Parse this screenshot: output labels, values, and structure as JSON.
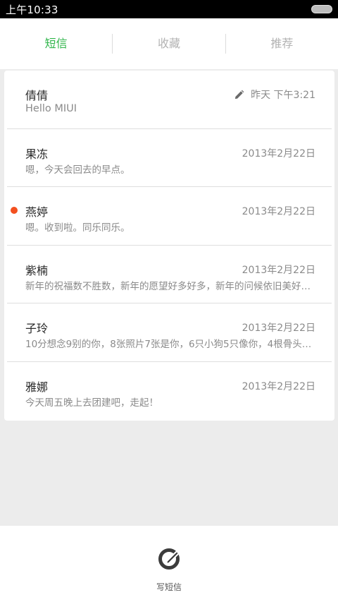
{
  "status_bar": {
    "time": "上午10:33"
  },
  "tabs": [
    {
      "label": "短信",
      "active": true
    },
    {
      "label": "收藏",
      "active": false
    },
    {
      "label": "推荐",
      "active": false
    }
  ],
  "conversations": [
    {
      "name": "倩倩",
      "preview": "Hello MIUI",
      "date": "昨天 下午3:21",
      "draft": true,
      "unread": false
    },
    {
      "name": "果冻",
      "preview": "嗯，今天会回去的早点。",
      "date": "2013年2月22日",
      "draft": false,
      "unread": false
    },
    {
      "name": "燕婷",
      "preview": "嗯。收到啦。同乐同乐。",
      "date": "2013年2月22日",
      "draft": false,
      "unread": true
    },
    {
      "name": "紫楠",
      "preview": "新年的祝福数不胜数，新年的愿望好多好多，新年的问候依旧美好…",
      "date": "2013年2月22日",
      "draft": false,
      "unread": false
    },
    {
      "name": "子玲",
      "preview": "10分想念9别的你，8张照片7张是你，6只小狗5只像你，4根骨头…",
      "date": "2013年2月22日",
      "draft": false,
      "unread": false
    },
    {
      "name": "雅娜",
      "preview": "今天周五晚上去团建吧，走起！",
      "date": "2013年2月22日",
      "draft": false,
      "unread": false
    }
  ],
  "compose": {
    "label": "写短信",
    "icon": "compose-icon"
  },
  "colors": {
    "accent": "#2fb54a",
    "unread": "#f3501f"
  }
}
